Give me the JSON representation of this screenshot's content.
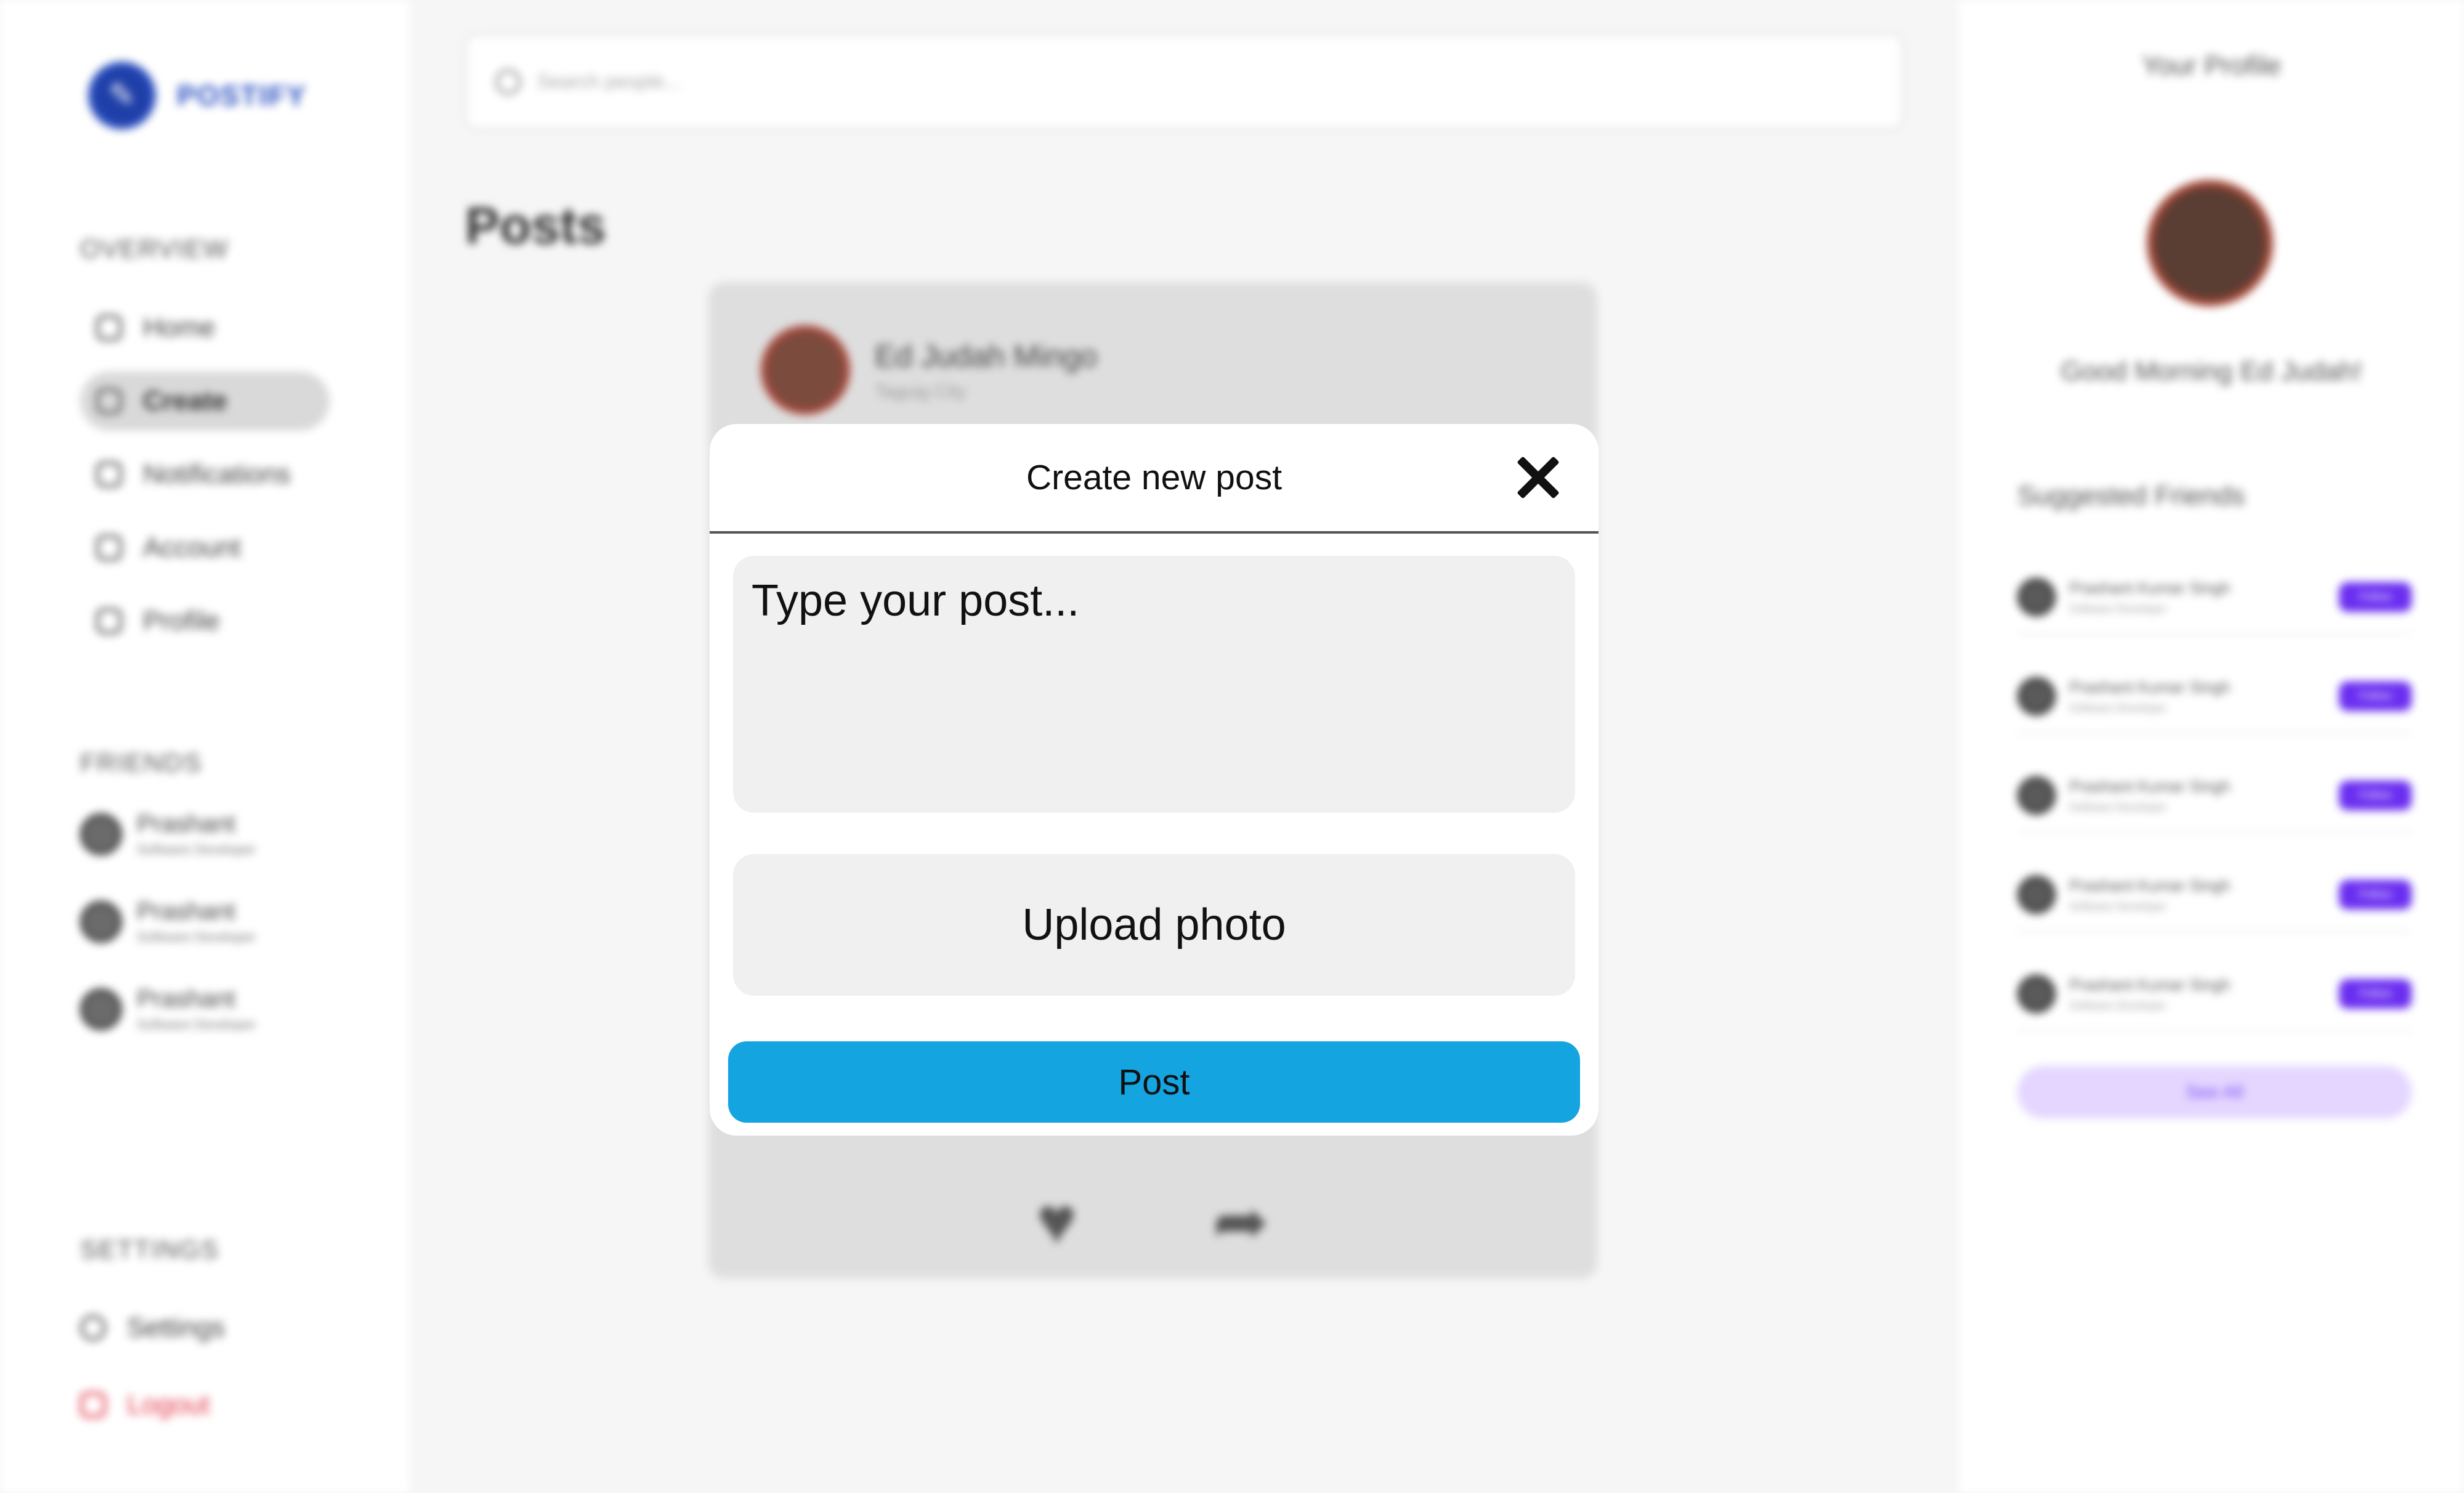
{
  "app": {
    "brand": "POSTIFY"
  },
  "sidebar": {
    "overview_title": "OVERVIEW",
    "items": [
      {
        "label": "Home",
        "icon": "home-icon"
      },
      {
        "label": "Create",
        "icon": "create-icon",
        "active": true
      },
      {
        "label": "Notifications",
        "icon": "bell-icon"
      },
      {
        "label": "Account",
        "icon": "user-icon"
      },
      {
        "label": "Profile",
        "icon": "profile-icon"
      }
    ],
    "friends_title": "FRIENDS",
    "friends": [
      {
        "name": "Prashant",
        "role": "Software Developer"
      },
      {
        "name": "Prashant",
        "role": "Software Developer"
      },
      {
        "name": "Prashant",
        "role": "Software Developer"
      }
    ],
    "settings_title": "SETTINGS",
    "settings_label": "Settings",
    "logout_label": "Logout"
  },
  "main": {
    "search_placeholder": "Search people...",
    "posts_title": "Posts",
    "post": {
      "author": "Ed Judah Mingo",
      "location": "Taguig City"
    }
  },
  "right": {
    "profile_title": "Your Profile",
    "greeting": "Good Morning Ed Judah!",
    "suggested_title": "Suggested Friends",
    "suggested": [
      {
        "name": "Prashant Kumar Singh",
        "role": "Software Developer",
        "action": "Follow"
      },
      {
        "name": "Prashant Kumar Singh",
        "role": "Software Developer",
        "action": "Follow"
      },
      {
        "name": "Prashant Kumar Singh",
        "role": "Software Developer",
        "action": "Follow"
      },
      {
        "name": "Prashant Kumar Singh",
        "role": "Software Developer",
        "action": "Follow"
      },
      {
        "name": "Prashant Kumar Singh",
        "role": "Software Developer",
        "action": "Follow"
      }
    ],
    "see_all": "See All"
  },
  "modal": {
    "title": "Create new post",
    "text_placeholder": "Type your post...",
    "upload_label": "Upload photo",
    "post_label": "Post"
  },
  "colors": {
    "brand": "#2a4fc0",
    "post_button": "#14a4e0",
    "follow": "#6a2ef0",
    "logout": "#e23a4b"
  }
}
